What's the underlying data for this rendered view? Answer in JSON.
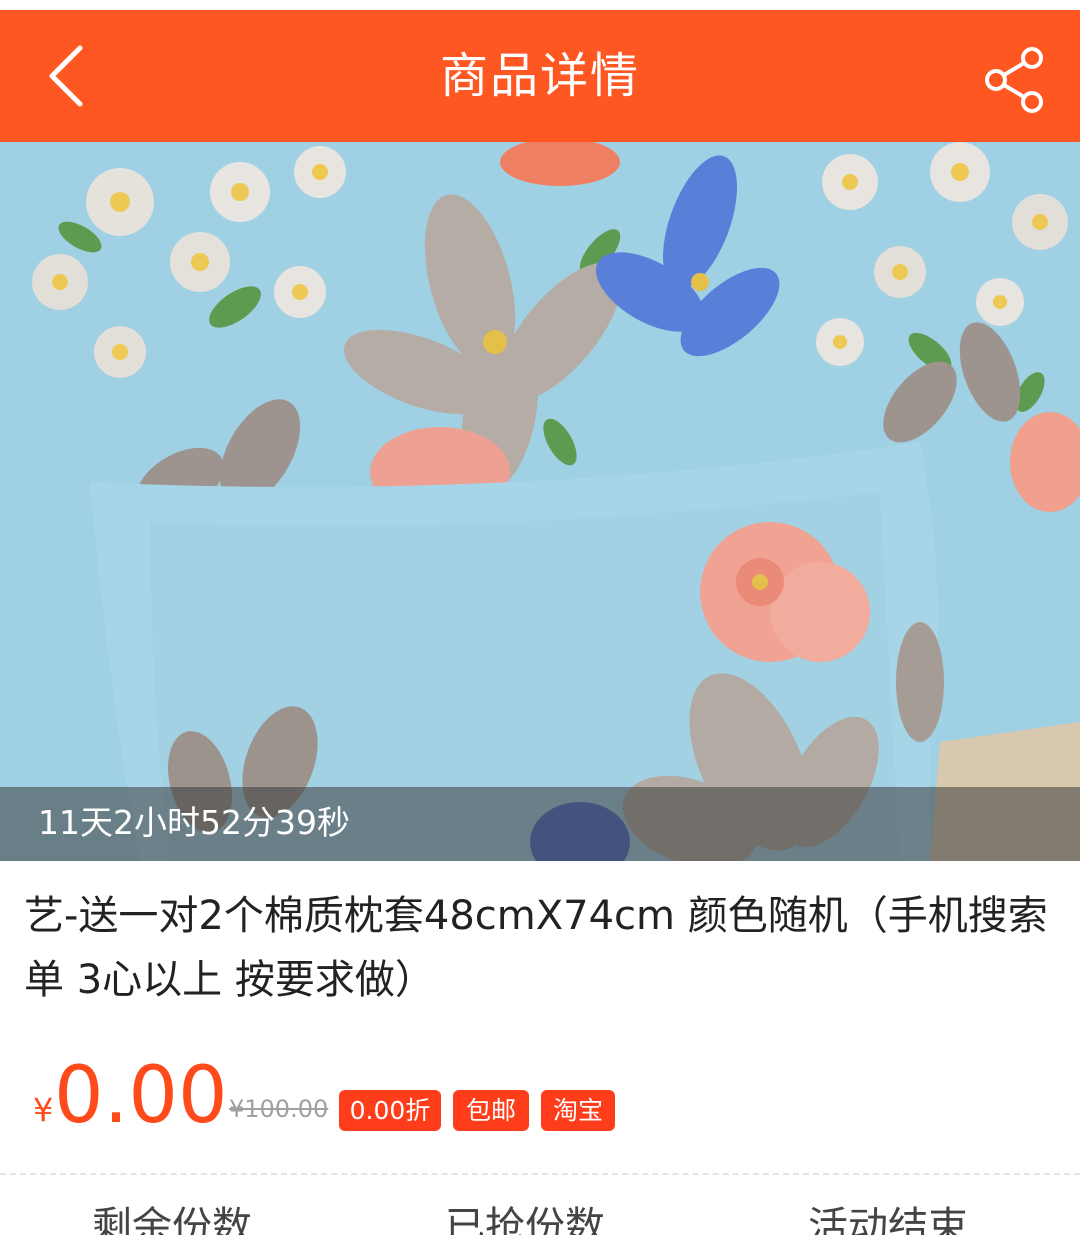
{
  "header": {
    "title": "商品详情"
  },
  "product": {
    "countdown": "11天2小时52分39秒",
    "title": "艺-送一对2个棉质枕套48cmX74cm 颜色随机（手机搜索单 3心以上 按要求做）",
    "currency_symbol": "¥",
    "price": "0.00",
    "original_price": "¥100.00",
    "tags": [
      "0.00折",
      "包邮",
      "淘宝"
    ]
  },
  "bottom_items": [
    "剩余份数",
    "已抢份数",
    "活动结束"
  ],
  "colors": {
    "accent": "#ff5722",
    "price": "#ff4a1c",
    "tag_bg": "#ff3d1a"
  },
  "icons": {
    "back": "chevron-left-icon",
    "share": "share-icon"
  }
}
